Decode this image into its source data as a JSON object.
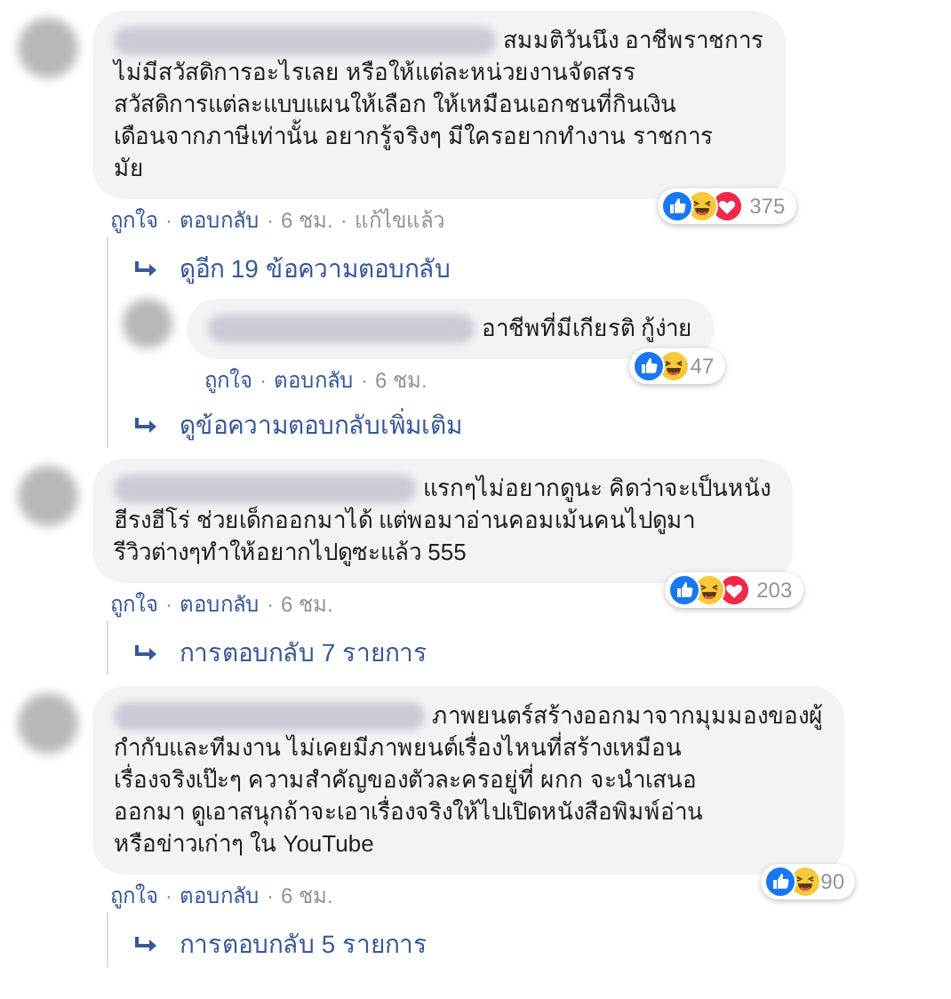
{
  "comments": [
    {
      "lines": [
        "สมมติวันนึง อาชีพราชการ",
        "ไม่มีสวัสดิการอะไรเลย หรือให้แต่ละหน่วยงานจัดสรร",
        "สวัสดิการแต่ละแบบแผนให้เลือก ให้เหมือนเอกชนที่กินเงิน",
        "เดือนจากภาษีเท่านั้น อยากรู้จริงๆ มีใครอยากทำงาน ราชการ",
        "มัย"
      ],
      "reactions": {
        "like": true,
        "haha": true,
        "love": true,
        "count": "375"
      },
      "meta": [
        "ถูกใจ",
        "·",
        "ตอบกลับ",
        "·",
        "6 ชม.",
        "·",
        "แก้ไขแล้ว"
      ],
      "replies": [
        {
          "kind": "link",
          "text": "ดูอีก 19 ข้อความตอบกลับ"
        },
        {
          "kind": "comment",
          "lines": [
            "อาชีพที่มีเกียรติ กู้ง่าย"
          ],
          "reactions": {
            "like": true,
            "haha": true,
            "love": false,
            "count": "47"
          },
          "meta": [
            "ถูกใจ",
            "·",
            "ตอบกลับ",
            "·",
            "6 ชม."
          ]
        },
        {
          "kind": "link",
          "text": "ดูข้อความตอบกลับเพิ่มเติม"
        }
      ]
    },
    {
      "lines": [
        "แรกๆไม่อยากดูนะ คิดว่าจะเป็นหนัง",
        "ฮีรงฮีโร่ ช่วยเด็กออกมาได้ แต่พอมาอ่านคอมเม้นคนไปดูมา",
        "รีวิวต่างๆทำให้อยากไปดูซะแล้ว 555"
      ],
      "reactions": {
        "like": true,
        "haha": true,
        "love": true,
        "count": "203"
      },
      "meta": [
        "ถูกใจ",
        "·",
        "ตอบกลับ",
        "·",
        "6 ชม."
      ],
      "replies": [
        {
          "kind": "link",
          "text": "การตอบกลับ 7 รายการ"
        }
      ]
    },
    {
      "lines": [
        "ภาพยนตร์สร้างออกมาจากมุมมองของผู้",
        "กำกับและทีมงาน ไม่เคยมีภาพยนต์เรื่องไหนที่สร้างเหมือน",
        "เรื่องจริงเป๊ะๆ ความสำคัญของตัวละครอยู่ที่ ผกก จะนำเสนอ",
        "ออกมา ดูเอาสนุกถ้าจะเอาเรื่องจริงให้ไปเปิดหนังสือพิมพ์อ่าน",
        "หรือข่าวเก่าๆ ใน YouTube"
      ],
      "reactions": {
        "like": true,
        "haha": true,
        "love": false,
        "count": "90"
      },
      "meta": [
        "ถูกใจ",
        "·",
        "ตอบกลับ",
        "·",
        "6 ชม."
      ],
      "replies": [
        {
          "kind": "link",
          "text": "การตอบกลับ 5 รายการ"
        }
      ]
    }
  ]
}
